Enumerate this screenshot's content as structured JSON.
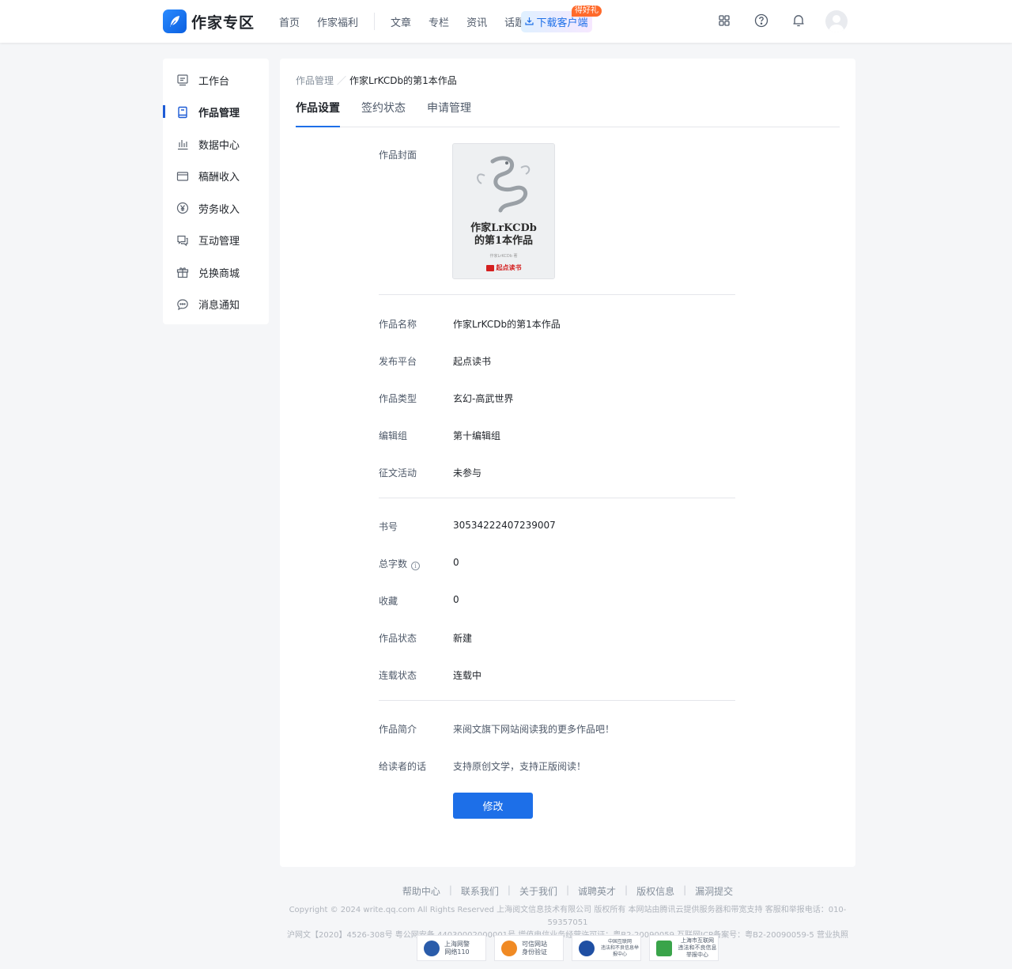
{
  "header": {
    "logo_text": "作家专区",
    "nav": [
      "首页",
      "作家福利",
      "文章",
      "专栏",
      "资讯",
      "话题"
    ],
    "download_label": "下载客户端",
    "gift_badge": "得好礼",
    "icons": [
      "grid-icon",
      "help-icon",
      "bell-icon",
      "avatar"
    ]
  },
  "sidebar": {
    "items": [
      {
        "label": "工作台",
        "icon": "workbench-icon"
      },
      {
        "label": "作品管理",
        "icon": "book-icon",
        "active": true
      },
      {
        "label": "数据中心",
        "icon": "chart-icon"
      },
      {
        "label": "稿酬收入",
        "icon": "card-icon"
      },
      {
        "label": "劳务收入",
        "icon": "yuan-icon"
      },
      {
        "label": "互动管理",
        "icon": "comments-icon"
      },
      {
        "label": "兑换商城",
        "icon": "gift-icon"
      },
      {
        "label": "消息通知",
        "icon": "message-icon"
      }
    ]
  },
  "breadcrumb": {
    "parent": "作品管理",
    "separator": "／",
    "current": "作家LrKCDb的第1本作品"
  },
  "tabs": [
    "作品设置",
    "签约状态",
    "申请管理"
  ],
  "cover": {
    "label": "作品封面",
    "title_line1": "作家LrKCDb",
    "title_line2": "的第1本作品",
    "author": "作家LrKCDb 著",
    "brand": "起点读书"
  },
  "fields": {
    "name": {
      "label": "作品名称",
      "value": "作家LrKCDb的第1本作品"
    },
    "platform": {
      "label": "发布平台",
      "value": "起点读书"
    },
    "genre": {
      "label": "作品类型",
      "value": "玄幻-高武世界"
    },
    "editor_group": {
      "label": "编辑组",
      "value": "第十编辑组"
    },
    "contest": {
      "label": "征文活动",
      "value": "未参与"
    },
    "book_id": {
      "label": "书号",
      "value": "30534222407239007"
    },
    "word_count": {
      "label": "总字数",
      "value": "0"
    },
    "favorites": {
      "label": "收藏",
      "value": "0"
    },
    "status": {
      "label": "作品状态",
      "value": "新建"
    },
    "serial_status": {
      "label": "连载状态",
      "value": "连载中"
    },
    "intro": {
      "label": "作品简介",
      "value": "来阅文旗下网站阅读我的更多作品吧！"
    },
    "reader_note": {
      "label": "给读者的话",
      "value": "支持原创文学，支持正版阅读！"
    }
  },
  "edit_button": "修改",
  "footer": {
    "links": [
      "帮助中心",
      "联系我们",
      "关于我们",
      "诚聘英才",
      "版权信息",
      "漏洞提交"
    ],
    "copyright_line1": "Copyright © 2024 write.qq.com All Rights Reserved 上海阅文信息技术有限公司 版权所有 本网站由腾讯云提供服务器和带宽支持 客服和举报电话：010-59357051",
    "copyright_line2": "沪网文【2020】4526-308号 粤公网安备 44030002000001号 增值电信业务经营许可证：粤B2-20090059 互联网ICP备案号：粤B2-20090059-5 营业执照",
    "badges": [
      {
        "line1": "上海网警",
        "line2": "网络110",
        "color": "#2a5caa"
      },
      {
        "line1": "可信网站",
        "line2": "身份验证",
        "color": "#f08a24"
      },
      {
        "line1": "中国互联网",
        "line2": "违法和不良信息举报中心",
        "color": "#1f4fa3"
      },
      {
        "line1": "上海市互联网",
        "line2": "违法和不良信息举报中心",
        "color": "#3aa44a"
      }
    ]
  },
  "colors": {
    "accent": "#1d6fe8",
    "active_sidebar": "#1d5bd6",
    "badge": "#ff6a2b"
  }
}
